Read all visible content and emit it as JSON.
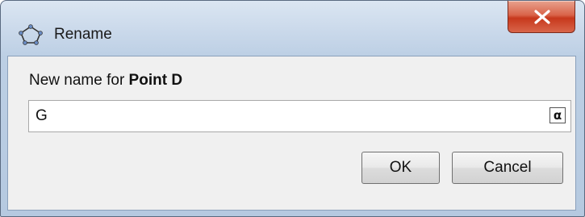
{
  "window": {
    "title": "Rename",
    "app_icon": "pentagon-outline-icon",
    "close_icon": "close-icon"
  },
  "dialog": {
    "prompt_prefix": "New name for ",
    "prompt_object": "Point D",
    "input_value": "G",
    "symbol_button_label": "α",
    "ok_label": "OK",
    "cancel_label": "Cancel"
  },
  "colors": {
    "close_button": "#c7381c",
    "client_background": "#f0f0f0",
    "frame": "#bccfe4"
  }
}
